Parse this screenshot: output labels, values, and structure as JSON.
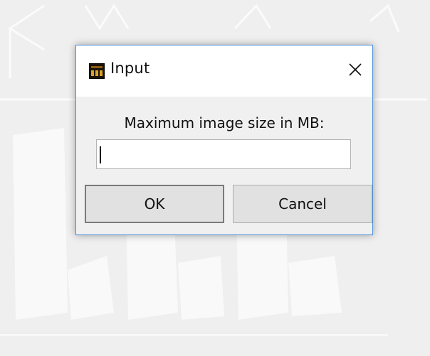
{
  "dialog": {
    "title": "Input",
    "icon": "app-logo-icon",
    "close_icon": "close-icon",
    "prompt": "Maximum image size in MB:",
    "input_value": "",
    "ok_label": "OK",
    "cancel_label": "Cancel"
  },
  "colors": {
    "window_bg": "#f0f0f0",
    "titlebar_bg": "#ffffff",
    "border_accent": "#4a90d9",
    "button_bg": "#e1e1e1"
  }
}
